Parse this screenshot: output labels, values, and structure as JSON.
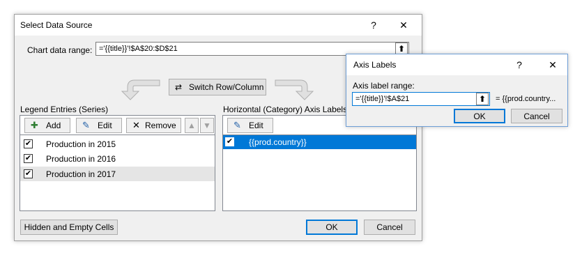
{
  "main": {
    "title": "Select Data Source",
    "help": "?",
    "close": "✕",
    "range_label": "Chart data range:",
    "range_value": "='{{title}}'!$A$20:$D$21",
    "switch_label": "Switch Row/Column",
    "legend_label": "Legend Entries (Series)",
    "add_label": "Add",
    "edit_label": "Edit",
    "remove_label": "Remove",
    "series": [
      {
        "label": "Production in 2015",
        "checked": true
      },
      {
        "label": "Production in 2016",
        "checked": true
      },
      {
        "label": "Production in 2017",
        "checked": true
      }
    ],
    "axis_label": "Horizontal (Category) Axis Labels",
    "axis_edit_label": "Edit",
    "categories": [
      {
        "label": "{{prod.country}}",
        "checked": true
      }
    ],
    "hidden_label": "Hidden and Empty Cells",
    "ok_label": "OK",
    "cancel_label": "Cancel"
  },
  "axis_dialog": {
    "title": "Axis Labels",
    "help": "?",
    "close": "✕",
    "range_label": "Axis label range:",
    "range_value": "='{{title}}'!$A$21",
    "preview": "= {{prod.country...",
    "ok_label": "OK",
    "cancel_label": "Cancel"
  },
  "colors": {
    "selection": "#0078d7",
    "hover_row": "#e5e5e5"
  },
  "icons": [
    "question-icon",
    "close-icon",
    "collapse-icon",
    "switch-icon",
    "arrow-left-icon",
    "arrow-right-icon",
    "add-icon",
    "edit-icon",
    "remove-icon",
    "up-icon",
    "down-icon",
    "checkbox-icon"
  ]
}
